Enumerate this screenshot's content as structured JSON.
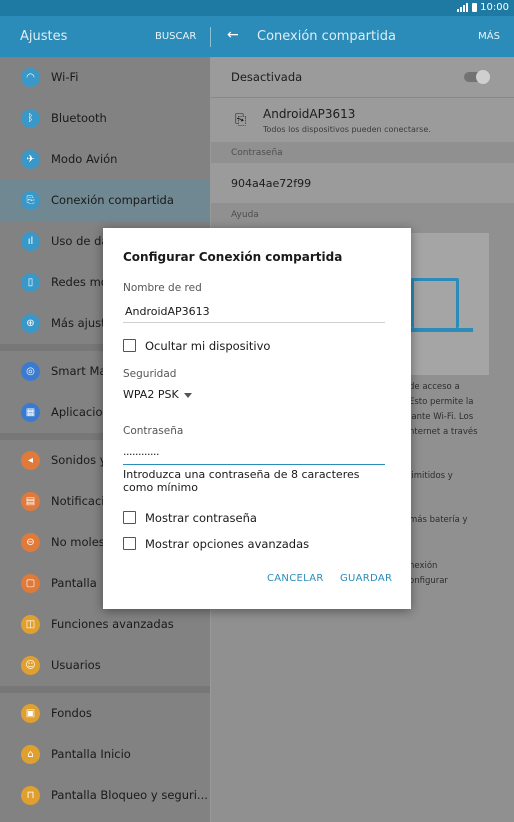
{
  "status": {
    "time": "10:00"
  },
  "appbar": {
    "title": "Ajustes",
    "search": "BUSCAR",
    "detail_title": "Conexión compartida",
    "more": "MÁS"
  },
  "sidebar": {
    "items": [
      {
        "label": "Wi-Fi",
        "color": "#3a98c8",
        "icon": "wifi-icon"
      },
      {
        "label": "Bluetooth",
        "color": "#3a98c8",
        "icon": "bluetooth-icon"
      },
      {
        "label": "Modo Avión",
        "color": "#3a98c8",
        "icon": "airplane-icon"
      },
      {
        "label": "Conexión compartida",
        "color": "#3a98c8",
        "icon": "hotspot-icon"
      },
      {
        "label": "Uso de da",
        "color": "#3a98c8",
        "icon": "data-usage-icon"
      },
      {
        "label": "Redes mó",
        "color": "#3a98c8",
        "icon": "mobile-network-icon"
      },
      {
        "label": "Más ajust",
        "color": "#3a98c8",
        "icon": "more-connections-icon"
      },
      {
        "label": "Smart Ma",
        "color": "#3a7bd0",
        "icon": "smart-manager-icon"
      },
      {
        "label": "Aplicacion",
        "color": "#3a7bd0",
        "icon": "apps-icon"
      },
      {
        "label": "Sonidos y",
        "color": "#e07a3a",
        "icon": "sound-icon"
      },
      {
        "label": "Notificacio",
        "color": "#e07a3a",
        "icon": "notification-icon"
      },
      {
        "label": "No molest",
        "color": "#e07a3a",
        "icon": "do-not-disturb-icon"
      },
      {
        "label": "Pantalla",
        "color": "#e07a3a",
        "icon": "display-icon"
      },
      {
        "label": "Funciones avanzadas",
        "color": "#e0a030",
        "icon": "advanced-features-icon"
      },
      {
        "label": "Usuarios",
        "color": "#e0a030",
        "icon": "users-icon"
      },
      {
        "label": "Fondos",
        "color": "#e0a030",
        "icon": "wallpaper-icon"
      },
      {
        "label": "Pantalla Inicio",
        "color": "#e0a030",
        "icon": "home-screen-icon"
      },
      {
        "label": "Pantalla Bloqueo y seguri...",
        "color": "#e0a030",
        "icon": "lock-icon"
      }
    ]
  },
  "detail": {
    "status_label": "Desactivada",
    "network_name": "AndroidAP3613",
    "network_sub": "Todos los dispositivos pueden conectarse.",
    "password_header": "Contraseña",
    "password_value": "904a4ae72f99",
    "help_header": "Ayuda",
    "help_lines": [
      "de acceso a",
      "Esto permite la",
      "iante Wi-Fi. Los",
      "nternet a través"
    ],
    "help_line2": "limitidos y",
    "help_line3": "más batería y",
    "help_lines4": [
      "nexión",
      "onfigurar"
    ]
  },
  "dialog": {
    "title": "Configurar Conexión compartida",
    "network_label": "Nombre de red",
    "network_value": "AndroidAP3613",
    "hide_label": "Ocultar mi dispositivo",
    "security_label": "Seguridad",
    "security_value": "WPA2 PSK",
    "password_label": "Contraseña",
    "password_value": "............",
    "hint": "Introduzca una contraseña de 8 caracteres como mínimo",
    "show_password": "Mostrar contraseña",
    "show_advanced": "Mostrar opciones avanzadas",
    "cancel": "CANCELAR",
    "save": "GUARDAR"
  }
}
